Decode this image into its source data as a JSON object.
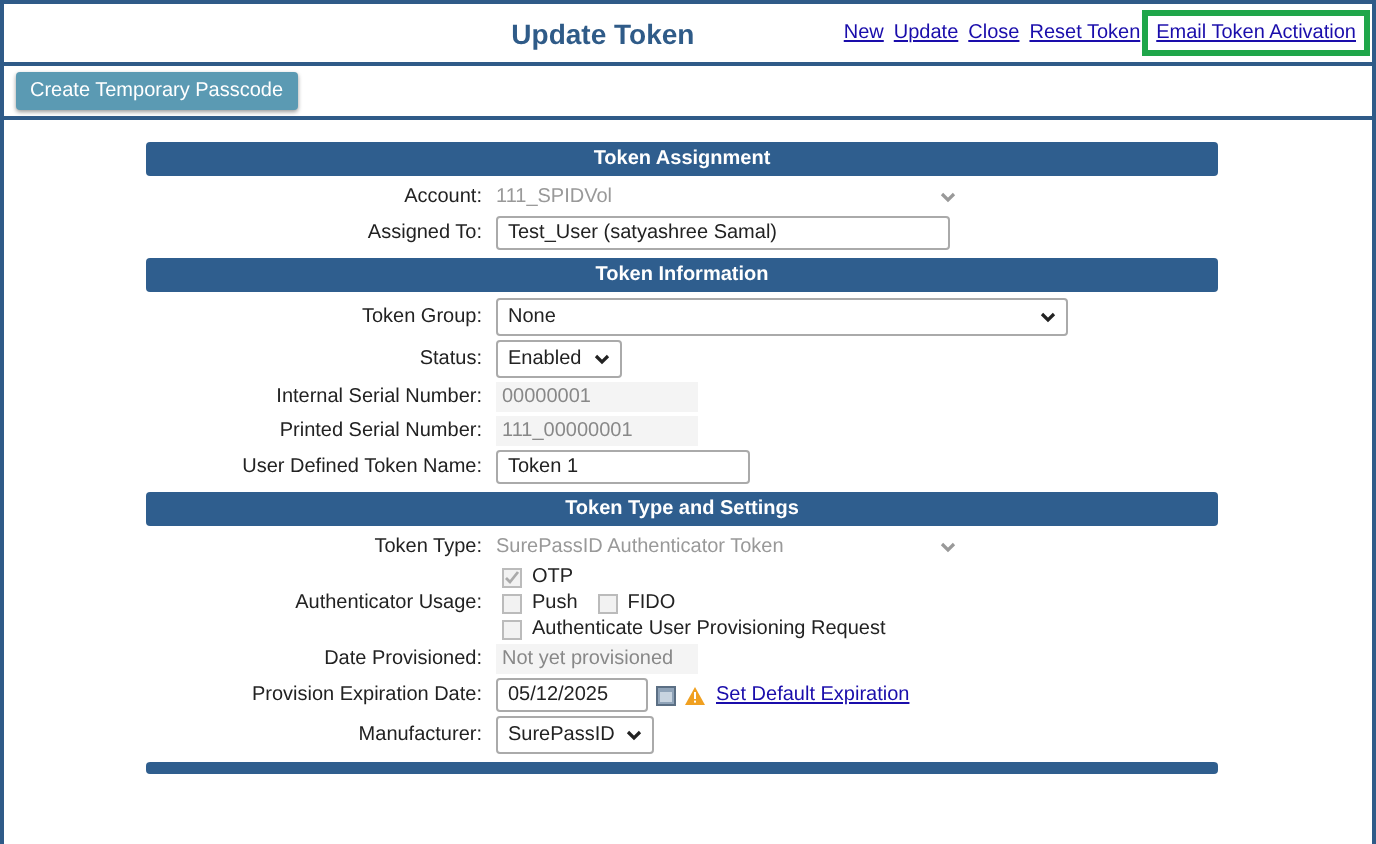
{
  "header": {
    "title": "Update Token",
    "links": [
      {
        "label": "New",
        "highlighted": false
      },
      {
        "label": "Update",
        "highlighted": false
      },
      {
        "label": "Close",
        "highlighted": false
      },
      {
        "label": "Reset Token",
        "highlighted": false
      },
      {
        "label": "Email Token Activation",
        "highlighted": true
      }
    ]
  },
  "toolbar": {
    "buttons": [
      "Create Temporary Passcode"
    ]
  },
  "sections": [
    {
      "title": "Token Assignment",
      "rows": [
        {
          "label": "Account:",
          "kind": "locked-select",
          "value": "111_SPIDVol"
        },
        {
          "label": "Assigned To:",
          "kind": "input-long",
          "value": "Test_User (satyashree Samal)"
        }
      ]
    },
    {
      "title": "Token Information",
      "rows": [
        {
          "label": "Token Group:",
          "kind": "select-long",
          "value": "None"
        },
        {
          "label": "Status:",
          "kind": "select-short",
          "value": "Enabled"
        },
        {
          "label": "Internal Serial Number:",
          "kind": "readonly",
          "value": "00000001"
        },
        {
          "label": "Printed Serial Number:",
          "kind": "readonly",
          "value": "111_00000001"
        },
        {
          "label": "User Defined Token Name:",
          "kind": "input-short",
          "value": "Token 1"
        }
      ]
    },
    {
      "title": "Token Type and Settings",
      "rows": [
        {
          "label": "Token Type:",
          "kind": "locked-select",
          "value": "SurePassID Authenticator Token"
        },
        {
          "label": "Authenticator Usage:",
          "kind": "checkboxes",
          "lines": [
            [
              {
                "label": "OTP",
                "checked": true
              }
            ],
            [
              {
                "label": "Push",
                "checked": false
              },
              {
                "label": "FIDO",
                "checked": false
              }
            ],
            [
              {
                "label": "Authenticate User Provisioning Request",
                "checked": false
              }
            ]
          ]
        },
        {
          "label": "Date Provisioned:",
          "kind": "readonly",
          "value": "Not yet provisioned"
        },
        {
          "label": "Provision Expiration Date:",
          "kind": "date",
          "value": "05/12/2025",
          "link": "Set Default Expiration"
        },
        {
          "label": "Manufacturer:",
          "kind": "select-short",
          "value": "SurePassID"
        }
      ]
    }
  ]
}
